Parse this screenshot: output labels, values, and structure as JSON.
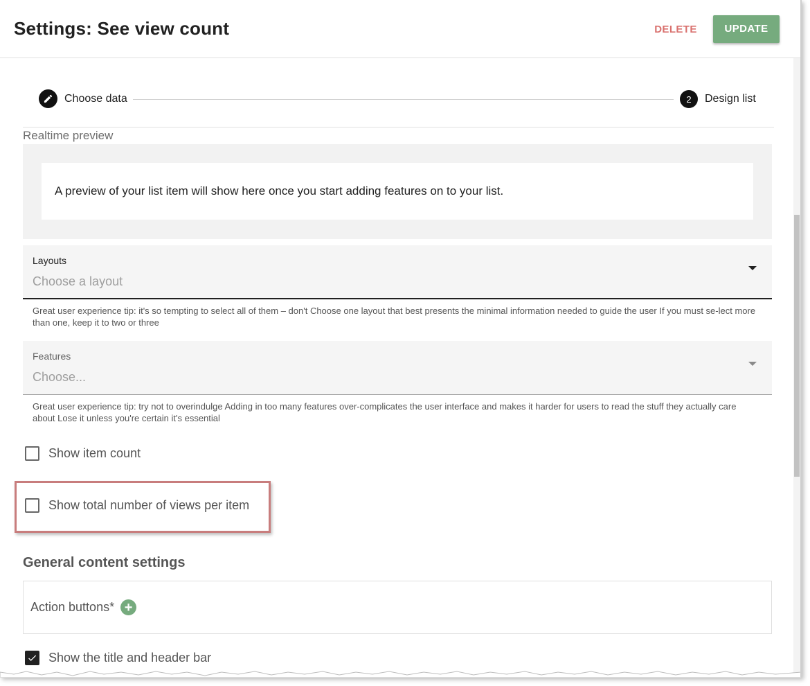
{
  "header": {
    "title": "Settings: See view count",
    "delete_label": "DELETE",
    "update_label": "UPDATE"
  },
  "stepper": {
    "steps": [
      {
        "label": "Choose data",
        "icon": "pencil-icon",
        "state": "completed"
      },
      {
        "label": "Design list",
        "number": "2",
        "state": "active"
      }
    ]
  },
  "preview": {
    "label": "Realtime preview",
    "message": "A preview of your list item will show here once you start adding features on to your list."
  },
  "layouts": {
    "label": "Layouts",
    "placeholder": "Choose a layout",
    "tip": "Great user experience tip: it's so tempting to select all of them – don't Choose one layout that best presents the minimal information needed to guide the user If you must se-lect more than one, keep it to two or three"
  },
  "features": {
    "label": "Features",
    "placeholder": "Choose...",
    "tip": "Great user experience tip: try not to overindulge Adding in too many features over-complicates the user interface and makes it harder for users to read the stuff they actually care about Lose it unless you're certain it's essential"
  },
  "checkboxes": {
    "item_count": {
      "label": "Show item count",
      "checked": false
    },
    "views_per_item": {
      "label": "Show total number of views per item",
      "checked": false
    },
    "title_header": {
      "label": "Show the title and header bar",
      "checked": true
    }
  },
  "general": {
    "title": "General content settings",
    "action_buttons_label": "Action buttons*"
  },
  "colors": {
    "accent_green": "#76ab7e",
    "delete_red": "#d9716e",
    "highlight_border": "#c87d7d"
  }
}
